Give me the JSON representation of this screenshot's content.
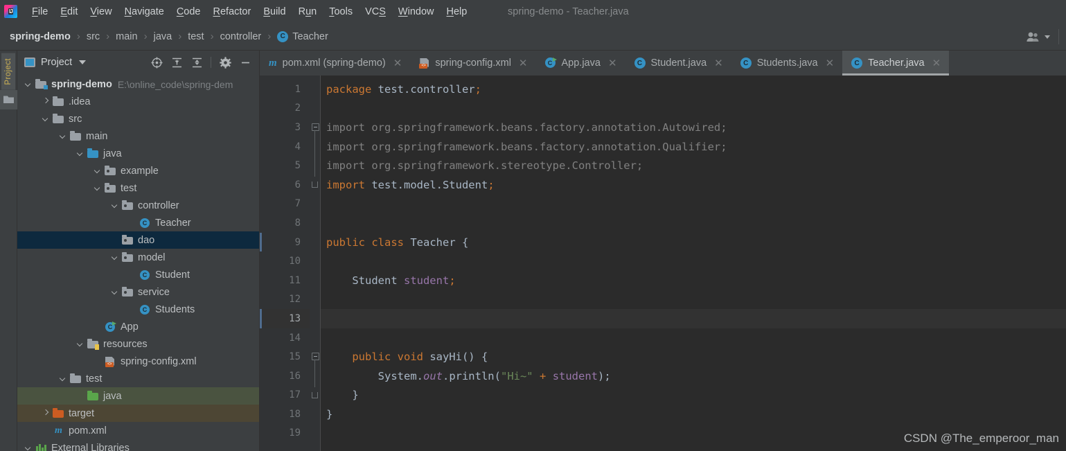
{
  "window": {
    "title": "spring-demo - Teacher.java",
    "logo_text": "IJ"
  },
  "menubar": {
    "items": [
      {
        "label": "File",
        "mnemonic": "F"
      },
      {
        "label": "Edit",
        "mnemonic": "E"
      },
      {
        "label": "View",
        "mnemonic": "V"
      },
      {
        "label": "Navigate",
        "mnemonic": "N"
      },
      {
        "label": "Code",
        "mnemonic": "C"
      },
      {
        "label": "Refactor",
        "mnemonic": "R"
      },
      {
        "label": "Build",
        "mnemonic": "B"
      },
      {
        "label": "Run",
        "mnemonic": "u"
      },
      {
        "label": "Tools",
        "mnemonic": "T"
      },
      {
        "label": "VCS",
        "mnemonic": "S"
      },
      {
        "label": "Window",
        "mnemonic": "W"
      },
      {
        "label": "Help",
        "mnemonic": "H"
      }
    ]
  },
  "breadcrumb": {
    "items": [
      "spring-demo",
      "src",
      "main",
      "java",
      "test",
      "controller"
    ],
    "leaf": "Teacher",
    "leaf_icon": "class-icon",
    "separator": "›"
  },
  "toolstrip": {
    "label": "Project",
    "icon": "folder-icon"
  },
  "project_panel": {
    "title": "Project",
    "title_icon": "project-view-icon",
    "dropdown_icon": "chevron-down-icon",
    "tools": [
      {
        "name": "locate-in-tree-icon",
        "label": "Select Opened File"
      },
      {
        "name": "expand-all-icon",
        "label": "Expand All"
      },
      {
        "name": "collapse-all-icon",
        "label": "Collapse All"
      },
      {
        "name": "gear-icon",
        "label": "Settings"
      },
      {
        "name": "hide-icon",
        "label": "Hide"
      }
    ],
    "tree": [
      {
        "label": "spring-demo",
        "sub": "E:\\online_code\\spring-dem",
        "depth": 0,
        "arrow": "down",
        "icon": "module-folder-icon",
        "bold": true,
        "state": "normal"
      },
      {
        "label": ".idea",
        "sub": "",
        "depth": 1,
        "arrow": "right",
        "icon": "folder-icon",
        "bold": false,
        "state": "normal"
      },
      {
        "label": "src",
        "sub": "",
        "depth": 1,
        "arrow": "down",
        "icon": "folder-icon",
        "bold": false,
        "state": "normal"
      },
      {
        "label": "main",
        "sub": "",
        "depth": 2,
        "arrow": "down",
        "icon": "folder-icon",
        "bold": false,
        "state": "normal"
      },
      {
        "label": "java",
        "sub": "",
        "depth": 3,
        "arrow": "down",
        "icon": "source-root-icon",
        "bold": false,
        "state": "normal"
      },
      {
        "label": "example",
        "sub": "",
        "depth": 4,
        "arrow": "down",
        "icon": "package-icon",
        "bold": false,
        "state": "normal"
      },
      {
        "label": "test",
        "sub": "",
        "depth": 4,
        "arrow": "down",
        "icon": "package-icon",
        "bold": false,
        "state": "normal"
      },
      {
        "label": "controller",
        "sub": "",
        "depth": 5,
        "arrow": "down",
        "icon": "package-icon",
        "bold": false,
        "state": "normal"
      },
      {
        "label": "Teacher",
        "sub": "",
        "depth": 6,
        "arrow": "none",
        "icon": "class-icon",
        "bold": false,
        "state": "normal"
      },
      {
        "label": "dao",
        "sub": "",
        "depth": 5,
        "arrow": "none",
        "icon": "package-icon",
        "bold": false,
        "state": "selected"
      },
      {
        "label": "model",
        "sub": "",
        "depth": 5,
        "arrow": "down",
        "icon": "package-icon",
        "bold": false,
        "state": "normal"
      },
      {
        "label": "Student",
        "sub": "",
        "depth": 6,
        "arrow": "none",
        "icon": "class-icon",
        "bold": false,
        "state": "normal"
      },
      {
        "label": "service",
        "sub": "",
        "depth": 5,
        "arrow": "down",
        "icon": "package-icon",
        "bold": false,
        "state": "normal"
      },
      {
        "label": "Students",
        "sub": "",
        "depth": 6,
        "arrow": "none",
        "icon": "class-icon",
        "bold": false,
        "state": "normal"
      },
      {
        "label": "App",
        "sub": "",
        "depth": 4,
        "arrow": "none",
        "icon": "runnable-class-icon",
        "bold": false,
        "state": "normal"
      },
      {
        "label": "resources",
        "sub": "",
        "depth": 3,
        "arrow": "down",
        "icon": "resource-root-icon",
        "bold": false,
        "state": "normal"
      },
      {
        "label": "spring-config.xml",
        "sub": "",
        "depth": 4,
        "arrow": "none",
        "icon": "spring-xml-icon",
        "bold": false,
        "state": "normal"
      },
      {
        "label": "test",
        "sub": "",
        "depth": 2,
        "arrow": "down",
        "icon": "folder-icon",
        "bold": false,
        "state": "normal"
      },
      {
        "label": "java",
        "sub": "",
        "depth": 3,
        "arrow": "none",
        "icon": "test-source-root-icon",
        "bold": false,
        "state": "green"
      },
      {
        "label": "target",
        "sub": "",
        "depth": 1,
        "arrow": "right",
        "icon": "excluded-folder-icon",
        "bold": false,
        "state": "target"
      },
      {
        "label": "pom.xml",
        "sub": "",
        "depth": 1,
        "arrow": "none",
        "icon": "maven-icon",
        "bold": false,
        "state": "normal"
      },
      {
        "label": "External Libraries",
        "sub": "",
        "depth": 0,
        "arrow": "down",
        "icon": "libraries-icon",
        "bold": false,
        "state": "normal"
      }
    ]
  },
  "editor_tabs": [
    {
      "label": "pom.xml (spring-demo)",
      "icon": "maven-icon",
      "active": false
    },
    {
      "label": "spring-config.xml",
      "icon": "spring-xml-icon",
      "active": false
    },
    {
      "label": "App.java",
      "icon": "runnable-class-icon",
      "active": false
    },
    {
      "label": "Student.java",
      "icon": "class-icon",
      "active": false
    },
    {
      "label": "Students.java",
      "icon": "class-icon",
      "active": false
    },
    {
      "label": "Teacher.java",
      "icon": "class-icon",
      "active": true
    }
  ],
  "editor": {
    "current_line": 13,
    "marked_lines": [
      9,
      13
    ],
    "line_numbers": [
      1,
      2,
      3,
      4,
      5,
      6,
      7,
      8,
      9,
      10,
      11,
      12,
      13,
      14,
      15,
      16,
      17,
      18,
      19
    ],
    "lines": [
      {
        "n": 1,
        "tokens": [
          {
            "t": "package ",
            "c": "kw"
          },
          {
            "t": "test.controller",
            "c": "plain"
          },
          {
            "t": ";",
            "c": "kw"
          }
        ]
      },
      {
        "n": 2,
        "tokens": []
      },
      {
        "n": 3,
        "tokens": [
          {
            "t": "import org.springframework.beans.factory.annotation.Autowired;",
            "c": "gray"
          }
        ]
      },
      {
        "n": 4,
        "tokens": [
          {
            "t": "import org.springframework.beans.factory.annotation.Qualifier;",
            "c": "gray"
          }
        ]
      },
      {
        "n": 5,
        "tokens": [
          {
            "t": "import org.springframework.stereotype.Controller;",
            "c": "gray"
          }
        ]
      },
      {
        "n": 6,
        "tokens": [
          {
            "t": "import ",
            "c": "kw"
          },
          {
            "t": "test.model.Student",
            "c": "plain"
          },
          {
            "t": ";",
            "c": "kw"
          }
        ]
      },
      {
        "n": 7,
        "tokens": []
      },
      {
        "n": 8,
        "tokens": []
      },
      {
        "n": 9,
        "tokens": [
          {
            "t": "public class ",
            "c": "kw"
          },
          {
            "t": "Teacher {",
            "c": "plain"
          }
        ]
      },
      {
        "n": 10,
        "tokens": []
      },
      {
        "n": 11,
        "tokens": [
          {
            "t": "    Student ",
            "c": "plain"
          },
          {
            "t": "student",
            "c": "fld"
          },
          {
            "t": ";",
            "c": "kw"
          }
        ]
      },
      {
        "n": 12,
        "tokens": []
      },
      {
        "n": 13,
        "tokens": []
      },
      {
        "n": 14,
        "tokens": []
      },
      {
        "n": 15,
        "tokens": [
          {
            "t": "    ",
            "c": "plain"
          },
          {
            "t": "public void ",
            "c": "kw"
          },
          {
            "t": "sayHi() {",
            "c": "plain"
          }
        ]
      },
      {
        "n": 16,
        "tokens": [
          {
            "t": "        System.",
            "c": "plain"
          },
          {
            "t": "out",
            "c": "stat"
          },
          {
            "t": ".println(",
            "c": "plain"
          },
          {
            "t": "\"Hi~\"",
            "c": "str"
          },
          {
            "t": " ",
            "c": "plain"
          },
          {
            "t": "+",
            "c": "kw"
          },
          {
            "t": " ",
            "c": "plain"
          },
          {
            "t": "student",
            "c": "fld"
          },
          {
            "t": ");",
            "c": "plain"
          }
        ]
      },
      {
        "n": 17,
        "tokens": [
          {
            "t": "    }",
            "c": "plain"
          }
        ]
      },
      {
        "n": 18,
        "tokens": [
          {
            "t": "}",
            "c": "plain"
          }
        ]
      },
      {
        "n": 19,
        "tokens": []
      }
    ],
    "fold_markers": [
      {
        "line": 3,
        "type": "square"
      },
      {
        "line": 6,
        "type": "end"
      },
      {
        "line": 15,
        "type": "square"
      },
      {
        "line": 17,
        "type": "end"
      }
    ]
  },
  "watermark": "CSDN @The_emperoor_man",
  "colors": {
    "accent_blue": "#3592c4",
    "keyword_orange": "#cc7832",
    "string_green": "#6a8759",
    "field_purple": "#9876aa",
    "editor_bg": "#2b2b2b",
    "chrome_bg": "#3c3f41",
    "selection_navy": "#0d293e"
  }
}
